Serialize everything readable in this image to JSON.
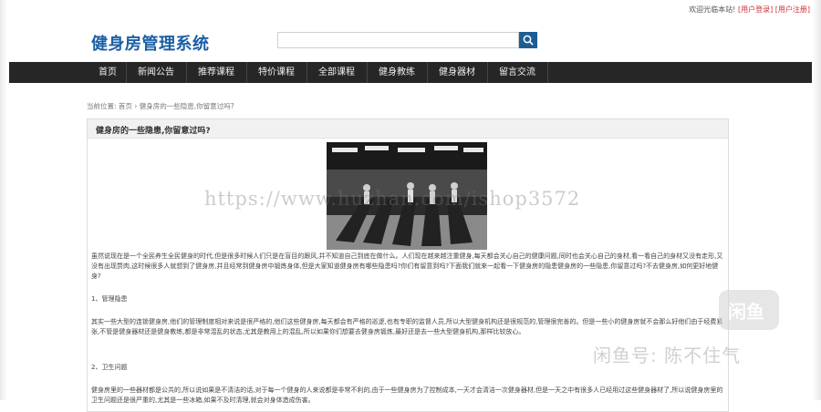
{
  "topbar": {
    "welcome": "欢迎光临本站!",
    "login": "[用户登录]",
    "register": "[用户注册]"
  },
  "site_title": "健身房管理系统",
  "search": {
    "placeholder": "",
    "button_icon": "search-icon"
  },
  "nav": [
    "首页",
    "新闻公告",
    "推荐课程",
    "特价课程",
    "全部课程",
    "健身教练",
    "健身器材",
    "留言交流"
  ],
  "breadcrumb": {
    "prefix": "当前位置:",
    "home": "首页",
    "separator": "›",
    "current": "健身房的一些隐患,你留意过吗?"
  },
  "article": {
    "title": "健身房的一些隐患,你留意过吗?",
    "paragraphs": [
      "虽然说现在是一个全民养生全民健身的时代,但是很多时候人们只是在盲目的跟风,并不知道自己到底在做什么。人们现在越来越注重健身,每天都会关心自己的健康问题,同时也会关心自己的身材,看一看自己的身材又没有走形,又没有出现赘肉,这时候很多人就想到了健身房,并且经常到健身房中锻炼身体,但是大家知道健身房有哪些隐患吗?你们有留意到吗?下面我们就来一起看一下健身房的隐患健身房的一些隐患,你留意过吗?不去健身房,如何更好地健身?",
      "",
      "1、管理隐患",
      "",
      "其实一些大型的连锁健身房,他们的管理制度相对来说是很严格的,他们这些健身房,每天都会有严格的巡逻,也有专职的监督人员,所以大型健身机构还是很规范的,管理很完善的。但是一些小的健身房就不会那么好他们由于经费紧张,不管是健身器材还是健身教练,都是非常混乱的状态,尤其是教用上的混乱,所以如果你们想要去健身房锻炼,最好还是去一些大型健身机构,那样比较放心。",
      "",
      "",
      "2、卫生问题",
      "",
      "健身房里的一些器材都是公共的,所以说如果是不清洁的话,对于每一个健身的人来说都是非常不利的,由于一些健身房为了控制成本,一天才会清洁一次健身器材,但是一天之中有很多人已经用过这些健身器材了,所以说健身房里的卫生问题还是很严重的,尤其是一些冰箱,如果不及时清理,就会对身体造成伤害。"
    ]
  },
  "watermarks": {
    "url": "https://www.huzhan.com/ishop3572",
    "logo_text": "闲鱼",
    "seller": "闲鱼号: 陈不住气"
  }
}
